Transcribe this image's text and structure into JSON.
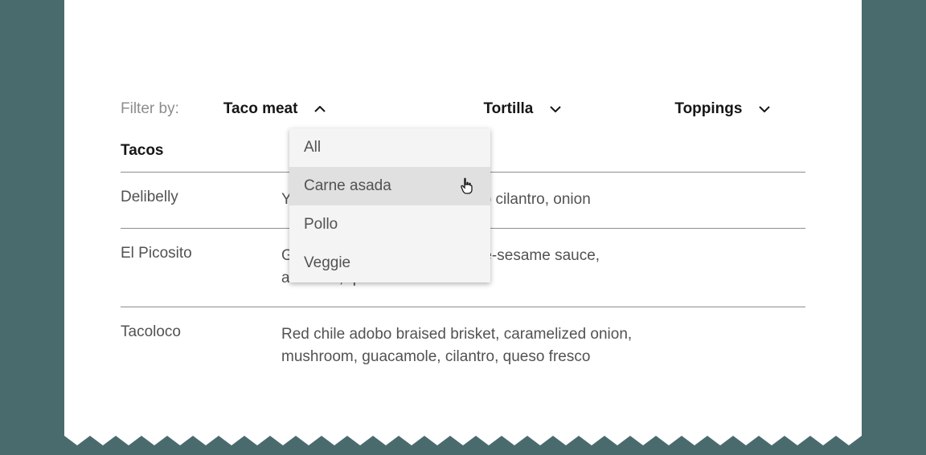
{
  "filter": {
    "label": "Filter by:",
    "dropdowns": [
      {
        "label": "Taco meat",
        "expanded": true
      },
      {
        "label": "Tortilla",
        "expanded": false
      },
      {
        "label": "Toppings",
        "expanded": false
      }
    ],
    "menu_options": [
      "All",
      "Carne asada",
      "Pollo",
      "Veggie"
    ],
    "hovered_index": 1
  },
  "table": {
    "header": "Tacos",
    "rows": [
      {
        "name": "Delibelly",
        "desc": "Yellow Honey tomatillo-serrano cilantro, onion"
      },
      {
        "name": "El Picosito",
        "desc": "Grilled beef tenderloin, chipotle-sesame sauce, avocado, queso fresco"
      },
      {
        "name": "Tacoloco",
        "desc": "Red chile adobo braised brisket, caramelized onion, mushroom, guacamole, cilantro, queso fresco"
      }
    ]
  }
}
